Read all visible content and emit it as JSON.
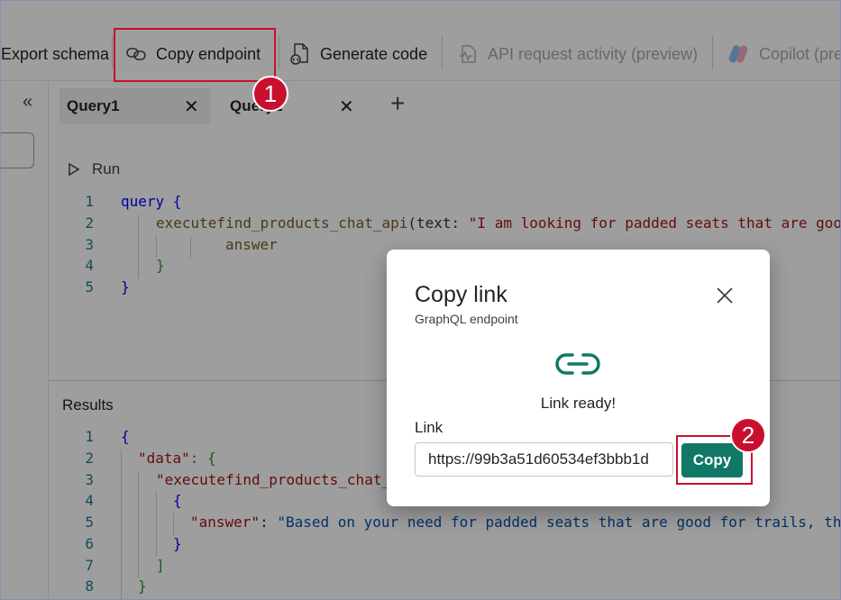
{
  "toolbar": {
    "export_schema": "Export schema",
    "copy_endpoint": "Copy endpoint",
    "generate_code": "Generate code",
    "api_activity": "API request activity (preview)",
    "copilot": "Copilot (pre"
  },
  "tabs": [
    {
      "label": "Query1",
      "active": true
    },
    {
      "label": "Query2",
      "active": false
    }
  ],
  "editor": {
    "run_label": "Run",
    "lines": [
      "1",
      "2",
      "3",
      "4",
      "5"
    ],
    "code": {
      "l1_kw": "query",
      "l1_brace": " {",
      "l2_fn": "executefind_products_chat_api",
      "l2_arg": "(text: ",
      "l2_str": "\"I am looking for padded seats that are goo",
      "l3": "answer",
      "l4": "}",
      "l5": "}"
    }
  },
  "results": {
    "label": "Results",
    "lines": [
      "1",
      "2",
      "3",
      "4",
      "5",
      "6",
      "7",
      "8"
    ],
    "code": {
      "l1": "{",
      "l2_key": "\"data\"",
      "l2_rest": ": {",
      "l3_key": "\"executefind_products_chat_",
      "l4": "{",
      "l5_key": "\"answer\"",
      "l5_colon": ": ",
      "l5_val": "\"Based on your need for padded seats that are good for trails, th",
      "l6": "}",
      "l7": "]",
      "l8": "}"
    }
  },
  "dialog": {
    "title": "Copy link",
    "subtitle": "GraphQL endpoint",
    "status": "Link ready!",
    "link_label": "Link",
    "link_value": "https://99b3a51d60534ef3bbb1d",
    "copy_button": "Copy"
  },
  "annotations": {
    "badge1": "1",
    "badge2": "2"
  },
  "colors": {
    "accent": "#117865",
    "highlight": "#c8102e"
  }
}
